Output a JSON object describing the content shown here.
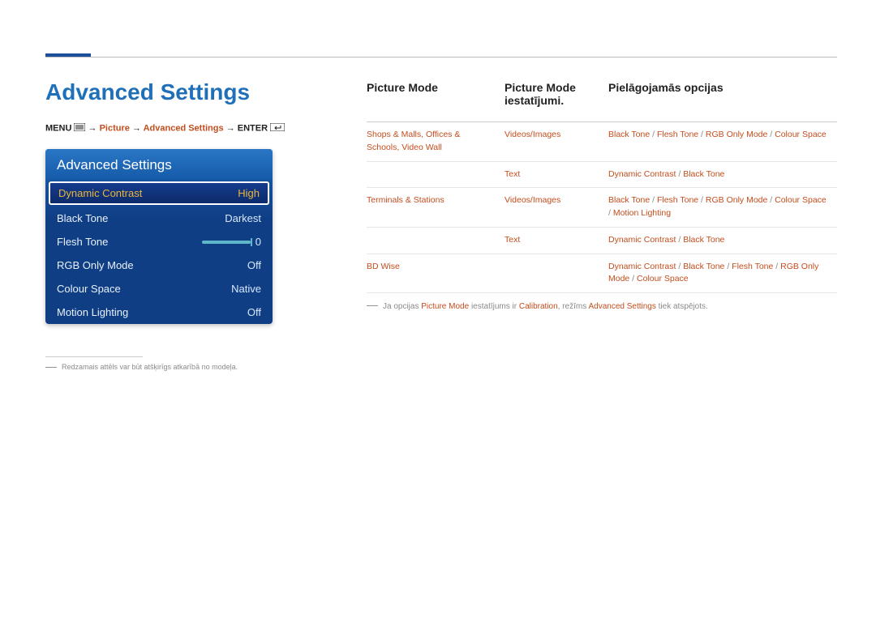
{
  "page_title": "Advanced Settings",
  "breadcrumb": {
    "menu": "MENU",
    "picture": "Picture",
    "advanced": "Advanced Settings",
    "enter": "ENTER",
    "arrow": "→"
  },
  "osd": {
    "title": "Advanced Settings",
    "rows": [
      {
        "label": "Dynamic Contrast",
        "value": "High",
        "selected": true
      },
      {
        "label": "Black Tone",
        "value": "Darkest"
      },
      {
        "label": "Flesh Tone",
        "value": "0",
        "slider": true
      },
      {
        "label": "RGB Only Mode",
        "value": "Off"
      },
      {
        "label": "Colour Space",
        "value": "Native"
      },
      {
        "label": "Motion Lighting",
        "value": "Off"
      }
    ]
  },
  "image_note": "Redzamais attēls var būt atšķirīgs atkarībā no modeļa.",
  "table": {
    "headers": [
      "Picture Mode",
      "Picture Mode iestatījumi.",
      "Pielāgojamās opcijas"
    ],
    "rows": [
      {
        "c1": "Shops & Malls, Offices & Schools, Video Wall",
        "c2": "Videos/Images",
        "c3": [
          "Black Tone",
          "Flesh Tone",
          "RGB Only Mode",
          "Colour Space"
        ]
      },
      {
        "c1": "",
        "c2": "Text",
        "c3": [
          "Dynamic Contrast",
          "Black Tone"
        ]
      },
      {
        "c1": "Terminals & Stations",
        "c2": "Videos/Images",
        "c3": [
          "Black Tone",
          "Flesh Tone",
          "RGB Only Mode",
          "Colour Space",
          "Motion Lighting"
        ]
      },
      {
        "c1": "",
        "c2": "Text",
        "c3": [
          "Dynamic Contrast",
          "Black Tone"
        ]
      },
      {
        "c1": "BD Wise",
        "c2": "",
        "c3": [
          "Dynamic Contrast",
          "Black Tone",
          "Flesh Tone",
          "RGB Only Mode",
          "Colour Space"
        ]
      }
    ]
  },
  "footnote": {
    "t1": "Ja opcijas ",
    "h1": "Picture Mode",
    "t2": " iestatījums ir ",
    "h2": "Calibration",
    "t3": ", režīms ",
    "h3": "Advanced Settings",
    "t4": " tiek atspējots."
  }
}
